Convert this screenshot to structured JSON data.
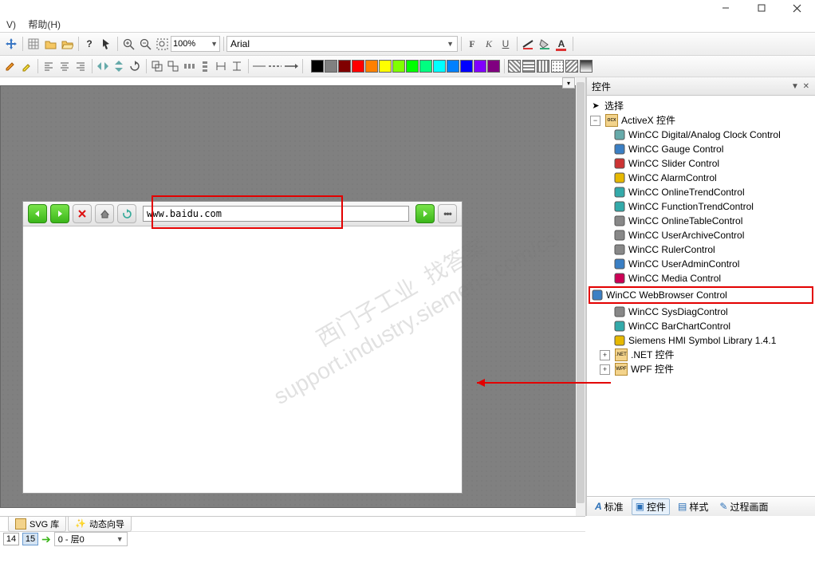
{
  "menubar": {
    "help": "帮助(H)"
  },
  "toolbar": {
    "zoom": "100%",
    "font": "Arial"
  },
  "palette_colors": [
    "#000000",
    "#808080",
    "#800000",
    "#ff0000",
    "#ff8000",
    "#ffff00",
    "#80ff00",
    "#00ff00",
    "#00ff80",
    "#00ffff",
    "#0080ff",
    "#0000ff",
    "#8000ff",
    "#800080"
  ],
  "browser": {
    "url": "www.baidu.com"
  },
  "watermark": "西门子工业  找答案\nsupport.industry.siemens.com/cs",
  "side": {
    "title": "控件",
    "root": "选择",
    "activex": "ActiveX 控件",
    "items": [
      "WinCC Digital/Analog Clock Control",
      "WinCC Gauge Control",
      "WinCC Slider Control",
      "WinCC AlarmControl",
      "WinCC OnlineTrendControl",
      "WinCC FunctionTrendControl",
      "WinCC OnlineTableControl",
      "WinCC UserArchiveControl",
      "WinCC RulerControl",
      "WinCC UserAdminControl",
      "WinCC Media Control",
      "WinCC WebBrowser Control",
      "WinCC SysDiagControl",
      "WinCC BarChartControl",
      "Siemens HMI Symbol Library 1.4.1"
    ],
    "highlight_index": 11,
    "net": ".NET 控件",
    "wpf": "WPF 控件",
    "tabs": {
      "std": "标准",
      "ctrl": "控件",
      "style": "样式",
      "proc": "过程画面"
    }
  },
  "bottom": {
    "svg": "SVG 库",
    "wiz": "动态向导",
    "page_prev": "14",
    "page_cur": "15",
    "layer": "0 - 层0"
  }
}
